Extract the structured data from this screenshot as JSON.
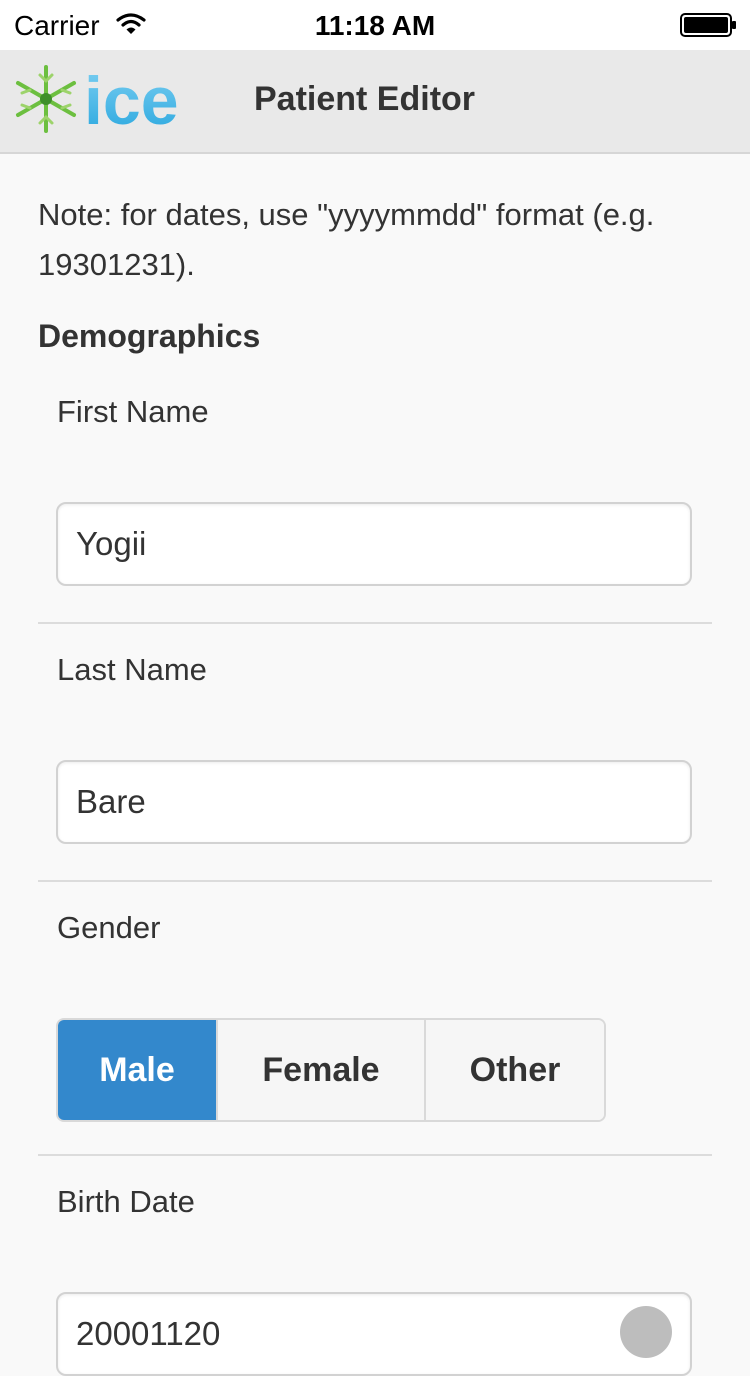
{
  "status_bar": {
    "carrier": "Carrier",
    "time": "11:18 AM"
  },
  "header": {
    "logo_text": "ice",
    "title": "Patient Editor"
  },
  "note": "Note: for dates, use \"yyyymmdd\" format (e.g. 19301231).",
  "section_title": "Demographics",
  "fields": {
    "first_name": {
      "label": "First Name",
      "value": "Yogii"
    },
    "last_name": {
      "label": "Last Name",
      "value": "Bare"
    },
    "gender": {
      "label": "Gender",
      "options": [
        "Male",
        "Female",
        "Other"
      ],
      "selected": "Male"
    },
    "birth_date": {
      "label": "Birth Date",
      "value": "20001120"
    }
  },
  "colors": {
    "accent": "#3388cc",
    "header_bg": "#e9e9e9",
    "page_bg": "#f9f9f9"
  }
}
